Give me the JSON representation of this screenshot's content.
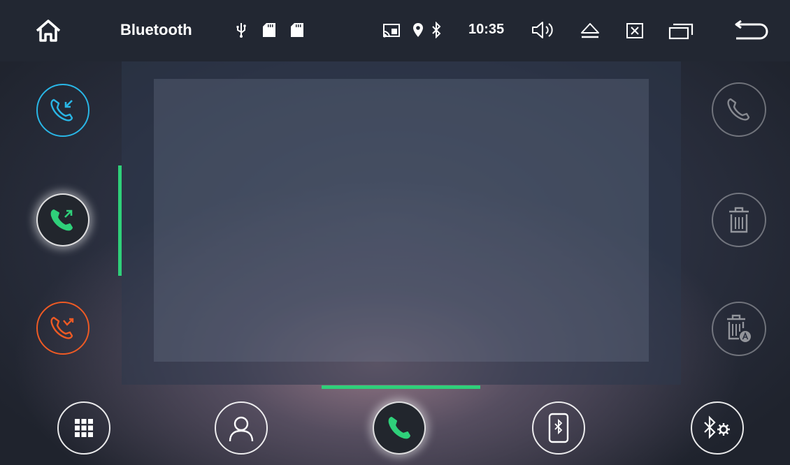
{
  "header": {
    "title": "Bluetooth",
    "time": "10:35"
  },
  "icons": {
    "home": "home-icon",
    "usb": "usb-icon",
    "sd1": "sd-card-icon",
    "sd2": "sd-card-icon",
    "cast": "cast-icon",
    "location": "location-icon",
    "bluetooth": "bluetooth-icon",
    "volume": "volume-icon",
    "eject": "eject-icon",
    "close": "close-window-icon",
    "recent": "recent-apps-icon",
    "back": "back-icon"
  },
  "left_tabs": [
    {
      "name": "received-calls",
      "color": "#29b6e6"
    },
    {
      "name": "dialed-calls",
      "color": "#2fd07a",
      "active": true
    },
    {
      "name": "missed-calls",
      "color": "#ee5a24"
    }
  ],
  "right_actions": [
    "call",
    "delete",
    "delete-all"
  ],
  "bottom_nav": [
    "dialpad",
    "contacts",
    "call-log",
    "bluetooth-device",
    "bluetooth-settings"
  ],
  "colors": {
    "accent": "#2fd07a",
    "received": "#29b6e6",
    "missed": "#ee5a24",
    "statusbar": "#222732"
  }
}
